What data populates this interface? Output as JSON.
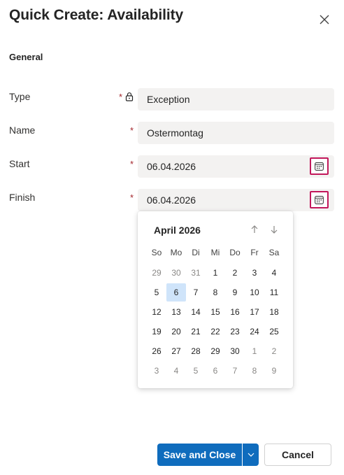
{
  "dialog": {
    "title": "Quick Create: Availability",
    "section": "General"
  },
  "fields": {
    "type": {
      "label": "Type",
      "required": "*",
      "value": "Exception"
    },
    "name": {
      "label": "Name",
      "required": "*",
      "value": "Ostermontag"
    },
    "start": {
      "label": "Start",
      "required": "*",
      "value": "06.04.2026"
    },
    "finish": {
      "label": "Finish",
      "required": "*",
      "value": "06.04.2026"
    }
  },
  "calendar": {
    "month_label": "April 2026",
    "weekdays": [
      "So",
      "Mo",
      "Di",
      "Mi",
      "Do",
      "Fr",
      "Sa"
    ],
    "weeks": [
      [
        "29",
        "30",
        "31",
        "1",
        "2",
        "3",
        "4"
      ],
      [
        "5",
        "6",
        "7",
        "8",
        "9",
        "10",
        "11"
      ],
      [
        "12",
        "13",
        "14",
        "15",
        "16",
        "17",
        "18"
      ],
      [
        "19",
        "20",
        "21",
        "22",
        "23",
        "24",
        "25"
      ],
      [
        "26",
        "27",
        "28",
        "29",
        "30",
        "1",
        "2"
      ],
      [
        "3",
        "4",
        "5",
        "6",
        "7",
        "8",
        "9"
      ]
    ],
    "selected": "6"
  },
  "footer": {
    "save_label": "Save and Close",
    "cancel_label": "Cancel"
  },
  "colors": {
    "accent": "#0f6cbd",
    "required": "#a4262c",
    "focus_border": "#c2185b",
    "selected_day": "#cfe4fa"
  },
  "icons": [
    "close-icon",
    "lock-icon",
    "calendar-icon",
    "arrow-up-icon",
    "arrow-down-icon",
    "chevron-down-icon"
  ]
}
